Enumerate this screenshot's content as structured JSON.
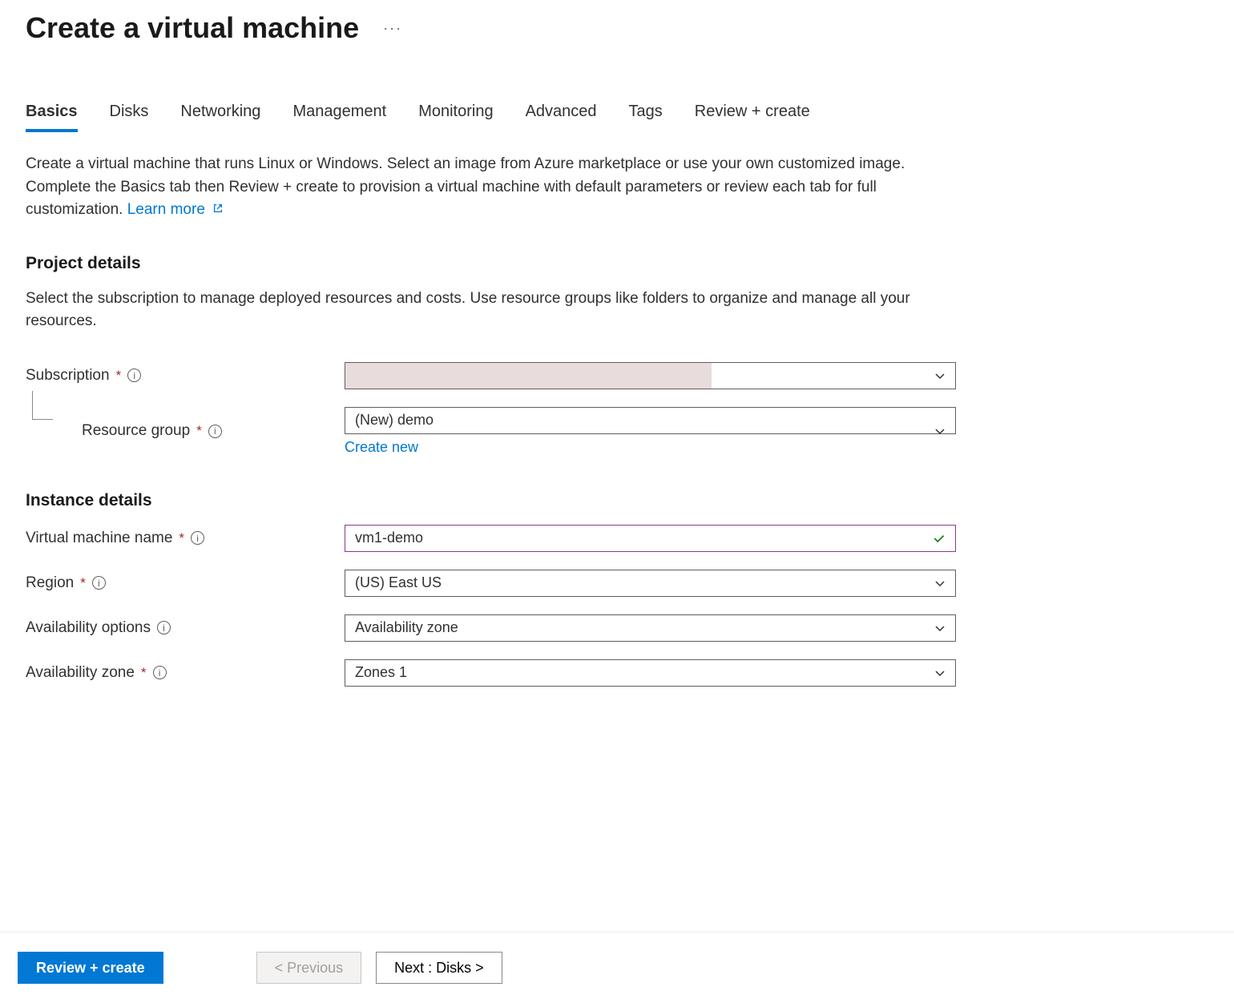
{
  "page": {
    "title": "Create a virtual machine"
  },
  "tabs": [
    {
      "label": "Basics",
      "active": true
    },
    {
      "label": "Disks",
      "active": false
    },
    {
      "label": "Networking",
      "active": false
    },
    {
      "label": "Management",
      "active": false
    },
    {
      "label": "Monitoring",
      "active": false
    },
    {
      "label": "Advanced",
      "active": false
    },
    {
      "label": "Tags",
      "active": false
    },
    {
      "label": "Review + create",
      "active": false
    }
  ],
  "intro": {
    "text": "Create a virtual machine that runs Linux or Windows. Select an image from Azure marketplace or use your own customized image. Complete the Basics tab then Review + create to provision a virtual machine with default parameters or review each tab for full customization.",
    "learn_more": "Learn more"
  },
  "project_details": {
    "header": "Project details",
    "desc": "Select the subscription to manage deployed resources and costs. Use resource groups like folders to organize and manage all your resources.",
    "subscription": {
      "label": "Subscription",
      "required": true,
      "value": ""
    },
    "resource_group": {
      "label": "Resource group",
      "required": true,
      "value": "(New) demo",
      "create_new": "Create new"
    }
  },
  "instance_details": {
    "header": "Instance details",
    "vm_name": {
      "label": "Virtual machine name",
      "required": true,
      "value": "vm1-demo"
    },
    "region": {
      "label": "Region",
      "required": true,
      "value": "(US) East US"
    },
    "availability_options": {
      "label": "Availability options",
      "required": false,
      "value": "Availability zone"
    },
    "availability_zone": {
      "label": "Availability zone",
      "required": true,
      "value": "Zones 1"
    }
  },
  "footer": {
    "review_create": "Review + create",
    "previous": "< Previous",
    "next": "Next : Disks >"
  }
}
